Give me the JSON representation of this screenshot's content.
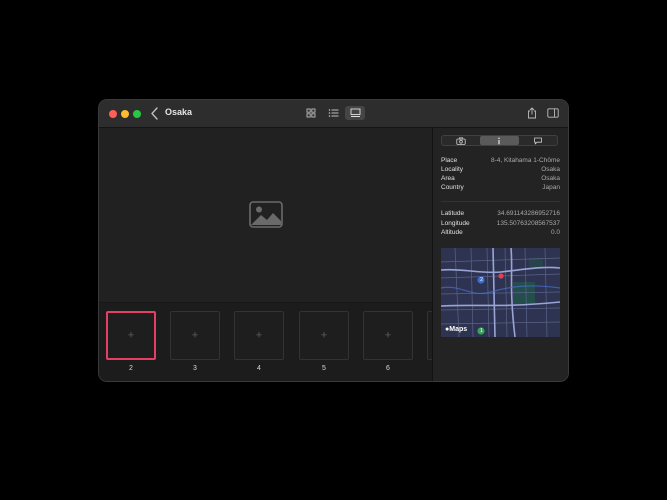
{
  "window": {
    "title": "Osaka"
  },
  "toolbar": {
    "view_modes": [
      "grid-view",
      "list-view",
      "gallery-view"
    ],
    "active_view": "gallery-view"
  },
  "thumbnails": [
    {
      "label": "2",
      "selected": true
    },
    {
      "label": "3",
      "selected": false
    },
    {
      "label": "4",
      "selected": false
    },
    {
      "label": "5",
      "selected": false
    },
    {
      "label": "6",
      "selected": false
    }
  ],
  "inspector": {
    "tabs": [
      "camera-icon",
      "info-icon",
      "comment-icon"
    ],
    "active_tab": "info-icon",
    "location": {
      "place_label": "Place",
      "place_value": "8-4, Kitahama 1-Chōme",
      "locality_label": "Locality",
      "locality_value": "Osaka",
      "area_label": "Area",
      "area_value": "Osaka",
      "country_label": "Country",
      "country_value": "Japan"
    },
    "coordinates": {
      "latitude_label": "Latitude",
      "latitude_value": "34.691143286952716",
      "longitude_label": "Longitude",
      "longitude_value": "135.50763208567537",
      "altitude_label": "Altitude",
      "altitude_value": "0.0"
    },
    "map": {
      "logo_text": "Maps",
      "highway_marker_1": "2",
      "highway_marker_2": "1"
    }
  },
  "colors": {
    "selection": "#e83e63",
    "window_bg": "#1f1f1f",
    "map_bg": "#2d3350"
  }
}
